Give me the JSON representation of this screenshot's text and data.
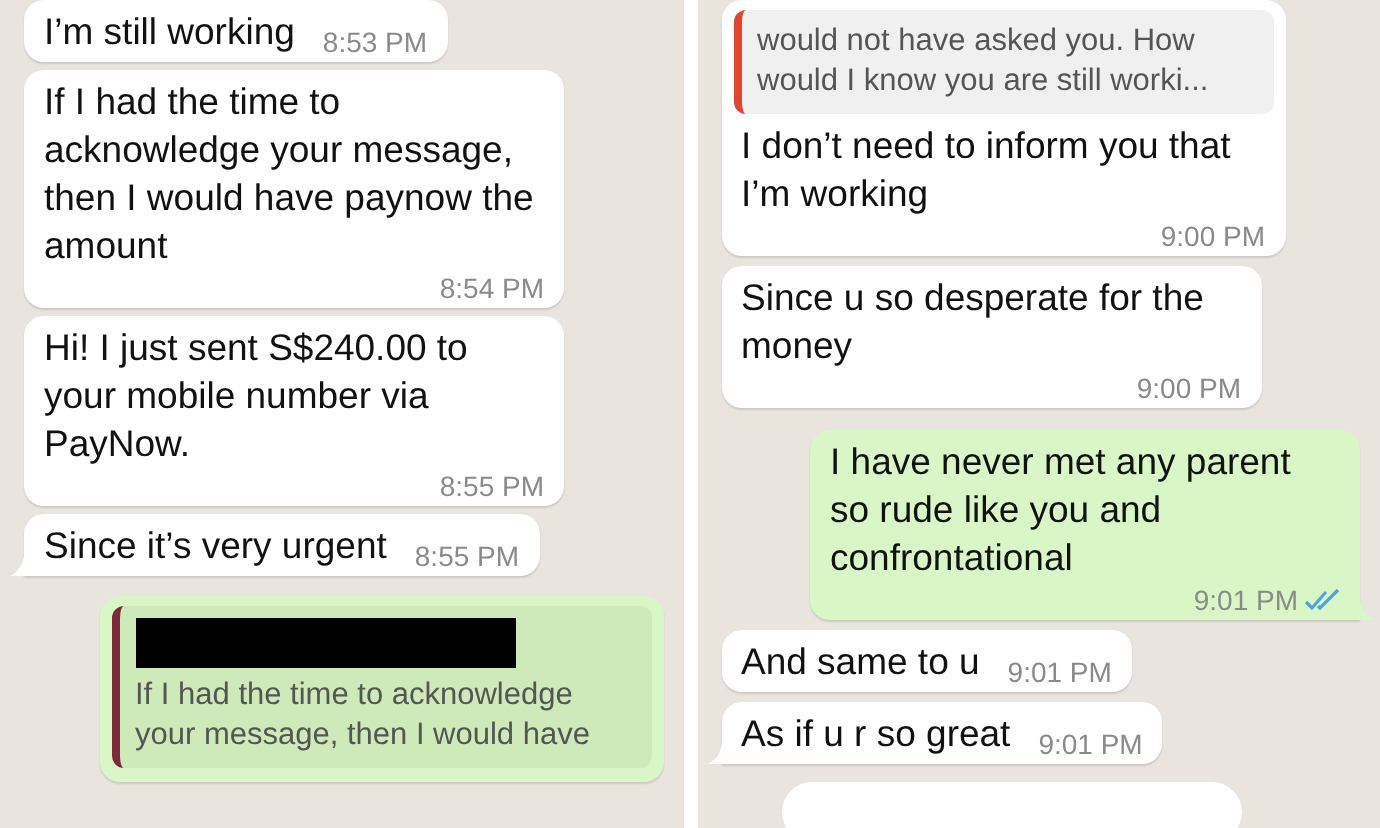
{
  "panels": [
    {
      "messages": [
        {
          "kind": "incoming",
          "text": "I’m still working",
          "time": "8:53 PM",
          "tail": false,
          "read": false
        },
        {
          "kind": "incoming",
          "text": "If I had the time to acknowledge your message, then I would have paynow the amount",
          "time": "8:54 PM",
          "tail": false,
          "read": false
        },
        {
          "kind": "incoming",
          "text": "Hi! I just sent S$240.00 to your mobile number via PayNow.",
          "time": "8:55 PM",
          "tail": false,
          "read": false
        },
        {
          "kind": "incoming",
          "text": "Since it’s very urgent",
          "time": "8:55 PM",
          "tail": true,
          "read": false
        },
        {
          "kind": "outgoing",
          "quote": {
            "redacted": true,
            "color": "#7a2a3a",
            "text": "If I had the time to acknowledge your message, then I would have"
          },
          "tail": false,
          "read": false
        }
      ]
    },
    {
      "messages": [
        {
          "kind": "incoming",
          "quote": {
            "redacted": false,
            "color": "#e0452e",
            "text": "would not have asked you. How would I know you are still worki..."
          },
          "text": "I don’t need to inform you that I’m working",
          "time": "9:00 PM",
          "tail": false,
          "read": false
        },
        {
          "kind": "incoming",
          "text": "Since u so desperate for the money",
          "time": "9:00 PM",
          "tail": false,
          "read": false
        },
        {
          "kind": "outgoing",
          "text": "I have never met any parent so rude like you and confrontational",
          "time": "9:01 PM",
          "tail": true,
          "read": true
        },
        {
          "kind": "incoming",
          "text": "And same to u",
          "time": "9:01 PM",
          "tail": false,
          "read": false
        },
        {
          "kind": "incoming",
          "text": "As if u r so great",
          "time": "9:01 PM",
          "tail": true,
          "read": false
        }
      ],
      "input_bar": true
    }
  ]
}
